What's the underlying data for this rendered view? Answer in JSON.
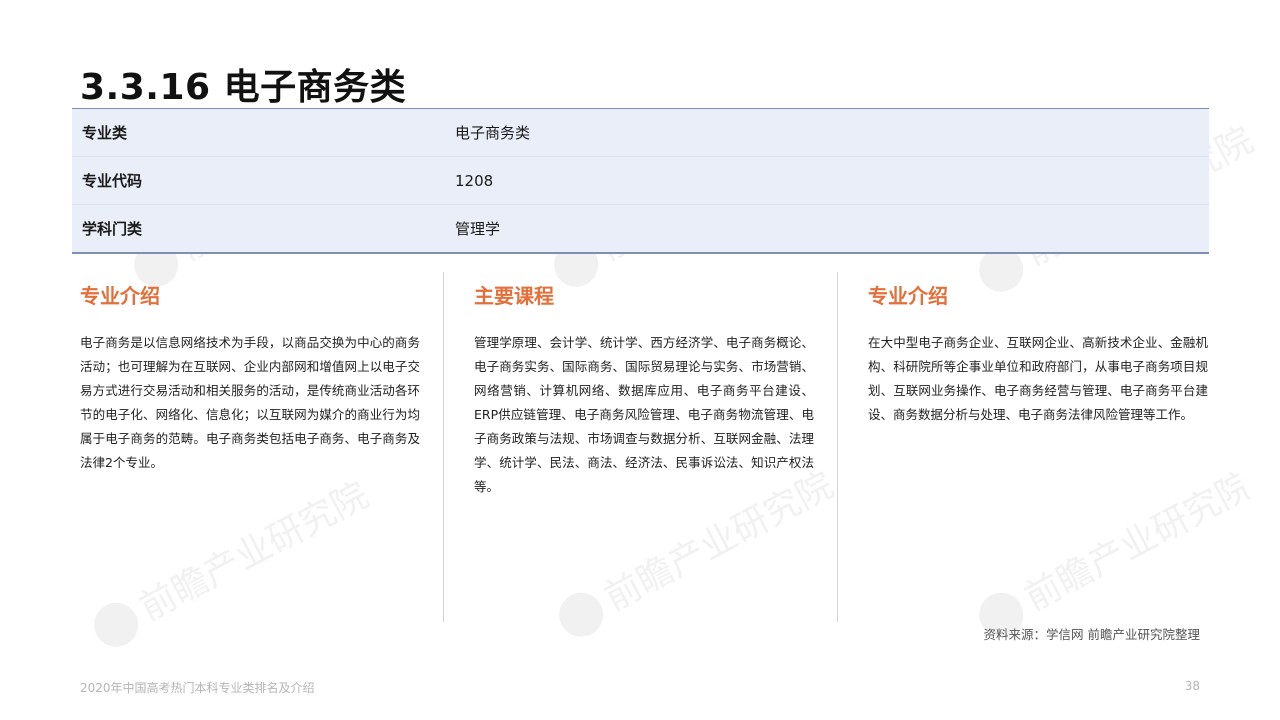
{
  "title": "3.3.16 电子商务类",
  "info_table": [
    {
      "key": "专业类",
      "value": "电子商务类"
    },
    {
      "key": "专业代码",
      "value": "1208"
    },
    {
      "key": "学科门类",
      "value": "管理学"
    }
  ],
  "columns": [
    {
      "heading": "专业介绍",
      "body": "电子商务是以信息网络技术为手段，以商品交换为中心的商务活动；也可理解为在互联网、企业内部网和增值网上以电子交易方式进行交易活动和相关服务的活动，是传统商业活动各环节的电子化、网络化、信息化；以互联网为媒介的商业行为均属于电子商务的范畴。电子商务类包括电子商务、电子商务及法律2个专业。"
    },
    {
      "heading": "主要课程",
      "body": "管理学原理、会计学、统计学、西方经济学、电子商务概论、电子商务实务、国际商务、国际贸易理论与实务、市场营销、网络营销、计算机网络、数据库应用、电子商务平台建设、ERP供应链管理、电子商务风险管理、电子商务物流管理、电子商务政策与法规、市场调查与数据分析、互联网金融、法理学、统计学、民法、商法、经济法、民事诉讼法、知识产权法等。"
    },
    {
      "heading": "专业介绍",
      "body": "在大中型电子商务企业、互联网企业、高新技术企业、金融机构、科研院所等企事业单位和政府部门，从事电子商务项目规划、互联网业务操作、电子商务经营与管理、电子商务平台建设、商务数据分析与处理、电子商务法律风险管理等工作。"
    }
  ],
  "source": "资料来源：学信网 前瞻产业研究院整理",
  "footer": {
    "left": "2020年中国高考热门本科专业类排名及介绍",
    "page": "38"
  },
  "watermark": {
    "main": "前瞻产业研究院"
  },
  "colors": {
    "accent": "#e2703a",
    "table_bg": "#e9eef8",
    "table_border": "#7d8fb8"
  }
}
